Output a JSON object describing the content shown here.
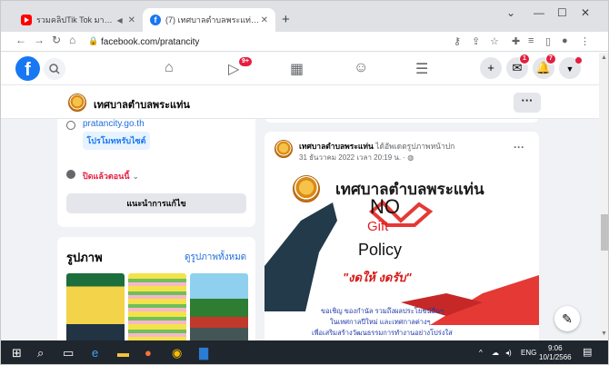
{
  "browser": {
    "tabs": [
      {
        "title": "รวมคลิปTik Tok มาแรง | ฝึกใ...",
        "favicon": "youtube-icon",
        "active": false
      },
      {
        "title": "(7) เทศบาลตำบลพระแท่น | Facebook",
        "favicon": "facebook-icon",
        "active": true
      }
    ],
    "url": "facebook.com/pratancity",
    "window_controls": [
      "⌄",
      "—",
      "☐",
      "✕"
    ]
  },
  "facebook": {
    "logo": "f",
    "badges": {
      "video": "9+",
      "messenger": "1",
      "notifications": "7"
    },
    "page_name": "เทศบาลตำบลพระแท่น",
    "more_label": "···"
  },
  "about": {
    "website": "pratancity.go.th",
    "promote_label": "โปรโมทหรับไซต์",
    "hours_label": "ปิดแล้วตอนนี้",
    "suggest_label": "แนะนำการแก้ไข"
  },
  "photos": {
    "heading": "รูปภาพ",
    "see_all": "ดูรูปภาพทั้งหมด"
  },
  "post": {
    "author": "เทศบาลตำบลพระแท่น",
    "action": "ได้อัพเดตรูปภาพหน้าปก",
    "date": "31 ธันวาคม 2022 เวลา 20:19 น. · ",
    "image": {
      "title": "เทศบาลตำบลพระแท่น",
      "no": "NO",
      "gift": "Gift",
      "policy": "Policy",
      "quote": "\"งดให้ งดรับ\"",
      "line1": "ขอเชิญ ของกำนัล รวมถึงผลประโยชน์อื่นๆ",
      "line2": "ในเทศกาลปีใหม่ และเทศกาลต่างๆ",
      "line3": "เพื่อเสริมสร้างวัฒนธรรมการทำงานอย่างโปร่งใส"
    }
  },
  "taskbar": {
    "time": "9:06",
    "date": "10/1/2566",
    "lang": "ENG"
  },
  "colors": {
    "fb_blue": "#1877f2",
    "badge_red": "#e41e3f",
    "taskbar": "#20262d"
  }
}
